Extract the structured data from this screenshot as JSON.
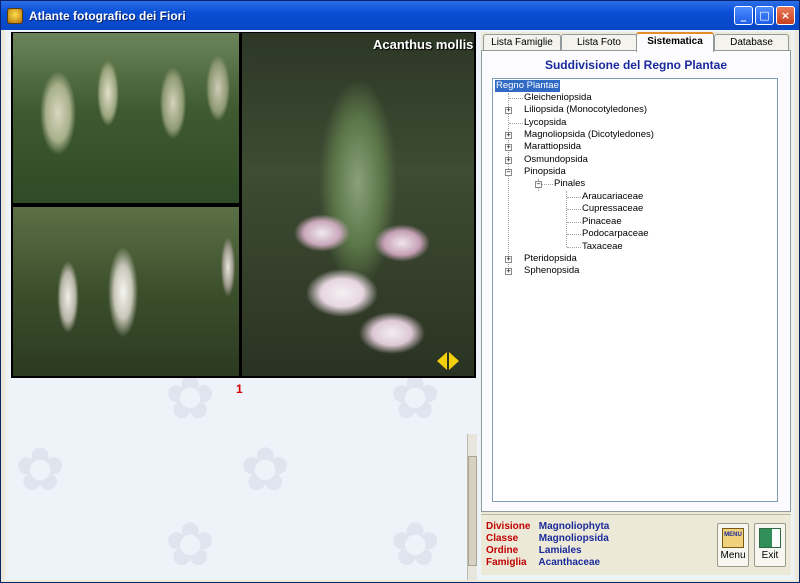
{
  "window": {
    "title": "Atlante fotografico dei Fiori",
    "minimize": "_",
    "maximize": "□",
    "close": "×"
  },
  "viewer": {
    "plant_name": "Acanthus mollis",
    "photo_index": "1"
  },
  "tabs": [
    {
      "label": "Lista Famiglie"
    },
    {
      "label": "Lista Foto"
    },
    {
      "label": "Sistematica",
      "active": true
    },
    {
      "label": "Database"
    }
  ],
  "panel": {
    "title": "Suddivisione del Regno Plantae"
  },
  "tree": {
    "root": "Regno Plantae",
    "items": [
      {
        "label": "Gleicheniopsida",
        "expander": ""
      },
      {
        "label": "Liliopsida (Monocotyledones)",
        "expander": "+"
      },
      {
        "label": "Lycopsida",
        "expander": ""
      },
      {
        "label": "Magnoliopsida (Dicotyledones)",
        "expander": "+"
      },
      {
        "label": "Marattiopsida",
        "expander": "+"
      },
      {
        "label": "Osmundopsida",
        "expander": "+"
      },
      {
        "label": "Pinopsida",
        "expander": "−"
      },
      {
        "label": "Pinales",
        "expander": "−"
      },
      {
        "label": "Araucariaceae",
        "expander": ""
      },
      {
        "label": "Cupressaceae",
        "expander": ""
      },
      {
        "label": "Pinaceae",
        "expander": ""
      },
      {
        "label": "Podocarpaceae",
        "expander": ""
      },
      {
        "label": "Taxaceae",
        "expander": ""
      },
      {
        "label": "Pteridopsida",
        "expander": "+"
      },
      {
        "label": "Sphenopsida",
        "expander": "+"
      }
    ]
  },
  "info": {
    "rows": [
      {
        "label": "Divisione",
        "value": "Magnoliophyta"
      },
      {
        "label": "Classe",
        "value": "Magnoliopsida"
      },
      {
        "label": "Ordine",
        "value": "Lamiales"
      },
      {
        "label": "Famiglia",
        "value": "Acanthaceae"
      }
    ],
    "menu_label": "Menu",
    "menu_icon_text": "MENU",
    "exit_label": "Exit"
  },
  "colors": {
    "title_bar": "#0a4fd6",
    "tree_selection": "#316ac5",
    "info_label": "#c00000",
    "info_value": "#1a2a9a",
    "photo_index": "#d40000",
    "arrows": "#f2d00a"
  }
}
